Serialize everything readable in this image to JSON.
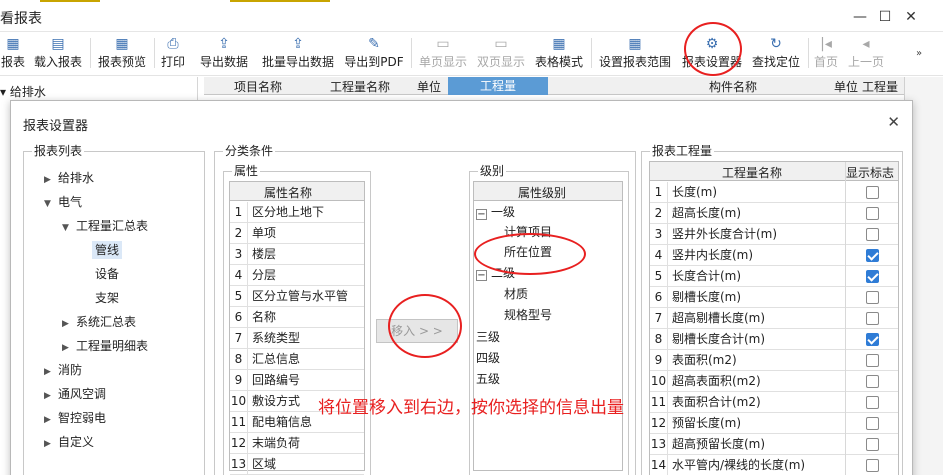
{
  "app": {
    "title": "看报表"
  },
  "toolbar": {
    "buttons": [
      {
        "label": "报表",
        "icon": "report-icon"
      },
      {
        "label": "载入报表",
        "icon": "load-report-icon"
      },
      {
        "label": "报表预览",
        "icon": "preview-icon"
      },
      {
        "label": "打印",
        "icon": "print-icon"
      },
      {
        "label": "导出数据",
        "icon": "export-icon"
      },
      {
        "label": "批量导出数据",
        "icon": "batch-export-icon"
      },
      {
        "label": "导出到PDF",
        "icon": "pdf-icon"
      },
      {
        "label": "单页显示",
        "icon": "single-page-icon"
      },
      {
        "label": "双页显示",
        "icon": "double-page-icon"
      },
      {
        "label": "表格模式",
        "icon": "table-mode-icon"
      },
      {
        "label": "设置报表范围",
        "icon": "range-icon"
      },
      {
        "label": "报表设置器",
        "icon": "report-settings-icon"
      },
      {
        "label": "查找定位",
        "icon": "locate-icon"
      },
      {
        "label": "首页",
        "icon": "first-page-icon"
      },
      {
        "label": "上一页",
        "icon": "prev-page-icon"
      }
    ]
  },
  "background": {
    "left_item": "给排水",
    "grid_headers": [
      "项目名称",
      "工程量名称",
      "单位",
      "工程量",
      "构件名称",
      "单位",
      "工程量"
    ]
  },
  "dialog": {
    "title": "报表设置器",
    "report_list": {
      "label": "报表列表",
      "items": [
        "给排水",
        "电气",
        "工程量汇总表",
        "管线",
        "设备",
        "支架",
        "系统汇总表",
        "工程量明细表",
        "消防",
        "通风空调",
        "智控弱电",
        "自定义"
      ]
    },
    "category": {
      "label": "分类条件",
      "attributes": {
        "label": "属性",
        "header": "属性名称",
        "rows": [
          "区分地上地下",
          "单项",
          "楼层",
          "分层",
          "区分立管与水平管",
          "名称",
          "系统类型",
          "汇总信息",
          "回路编号",
          "敷设方式",
          "配电箱信息",
          "末端负荷",
          "区域"
        ]
      },
      "move_button": "移入 > >",
      "levels": {
        "label": "级别",
        "header": "属性级别",
        "items": [
          "一级",
          "计算项目",
          "所在位置",
          "二级",
          "材质",
          "规格型号",
          "三级",
          "四级",
          "五级"
        ]
      }
    },
    "quantities": {
      "label": "报表工程量",
      "headers": [
        "工程量名称",
        "显示标志"
      ],
      "rows": [
        {
          "name": "长度(m)",
          "checked": false
        },
        {
          "name": "超高长度(m)",
          "checked": false
        },
        {
          "name": "竖井外长度合计(m)",
          "checked": false
        },
        {
          "name": "竖井内长度(m)",
          "checked": true
        },
        {
          "name": "长度合计(m)",
          "checked": true
        },
        {
          "name": "剔槽长度(m)",
          "checked": false
        },
        {
          "name": "超高剔槽长度(m)",
          "checked": false
        },
        {
          "name": "剔槽长度合计(m)",
          "checked": true
        },
        {
          "name": "表面积(m2)",
          "checked": false
        },
        {
          "name": "超高表面积(m2)",
          "checked": false
        },
        {
          "name": "表面积合计(m2)",
          "checked": false
        },
        {
          "name": "预留长度(m)",
          "checked": false
        },
        {
          "name": "超高预留长度(m)",
          "checked": false
        },
        {
          "name": "水平管内/裸线的长度(m)",
          "checked": false
        }
      ]
    }
  },
  "annotation": {
    "text": "将位置移入到右边，按你选择的信息出量"
  },
  "colors": {
    "accent": "#5b9bd5",
    "checkbox": "#2f7cd6",
    "annotation": "#e82020"
  }
}
